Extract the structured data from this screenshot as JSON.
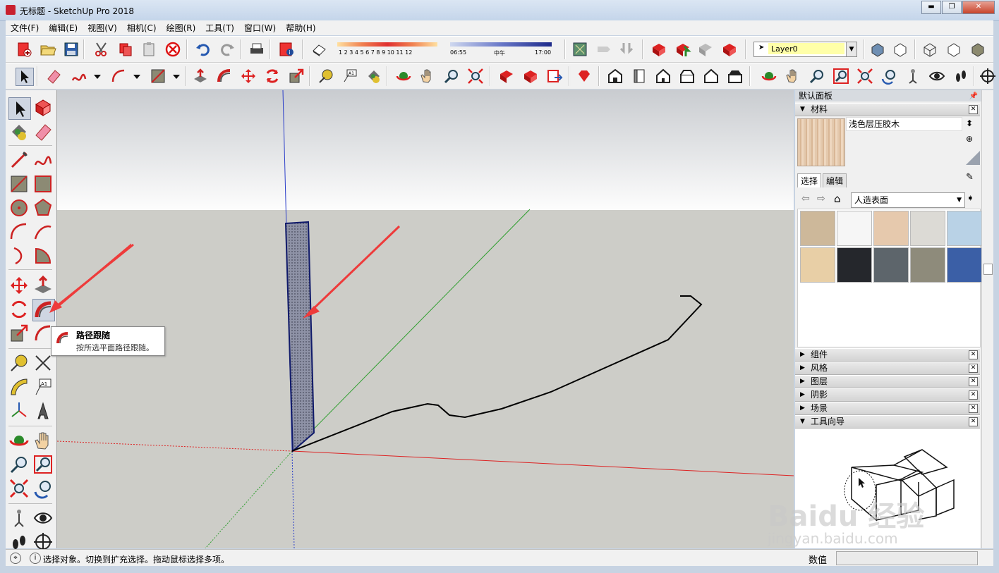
{
  "window": {
    "title": "无标题 - SketchUp Pro 2018",
    "minimize": "▬",
    "maximize": "❐",
    "close": "✕"
  },
  "menu": [
    "文件(F)",
    "编辑(E)",
    "视图(V)",
    "相机(C)",
    "绘图(R)",
    "工具(T)",
    "窗口(W)",
    "帮助(H)"
  ],
  "shadow": {
    "months": "1 2 3 4 5 6 7 8 9 10 11 12",
    "time_start": "06:55",
    "time_mid": "中午",
    "time_end": "17:00"
  },
  "layer": {
    "name": "Layer0"
  },
  "tooltip": {
    "title": "路径跟随",
    "description": "按所选平面路径跟随。"
  },
  "tray": {
    "title": "默认面板",
    "materials": {
      "header": "材料",
      "current_name": "浅色层压胶木",
      "tab_select": "选择",
      "tab_edit": "编辑",
      "library": "人造表面",
      "swatch_colors": [
        "#cdb89a",
        "#f6f6f6",
        "#e6c9ad",
        "#dcdad5",
        "#b9d2e6",
        "#e8cfa6",
        "#25272c",
        "#5d656b",
        "#8e8b7b",
        "#3b5fa6"
      ]
    },
    "collapsed_panels": [
      "组件",
      "风格",
      "图层",
      "阴影",
      "场景"
    ],
    "guide_panel": "工具向导"
  },
  "status": {
    "message": "选择对象。切换到扩充选择。拖动鼠标选择多项。",
    "vcb_label": "数值"
  },
  "watermark": {
    "line1": "Baidu 经验",
    "line2": "jingyan.baidu.com"
  }
}
